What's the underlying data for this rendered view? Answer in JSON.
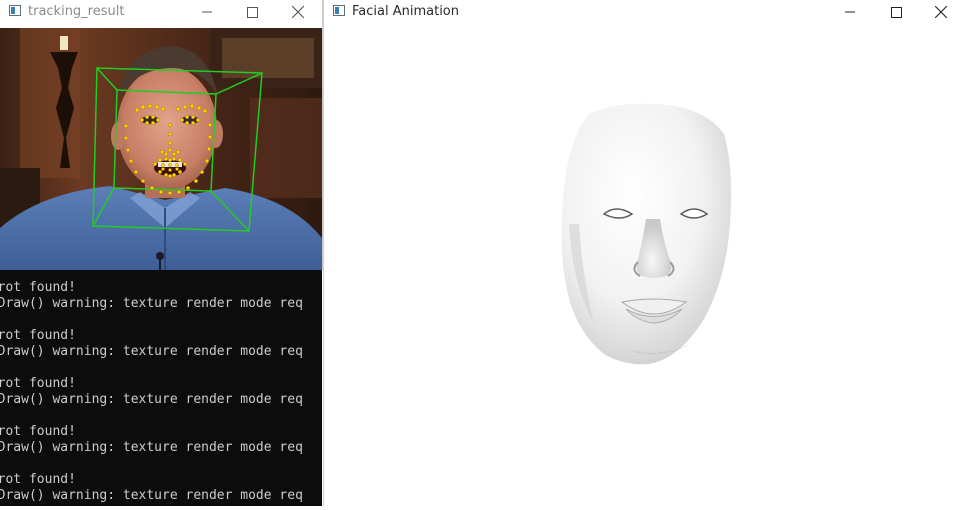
{
  "windows": {
    "tracking": {
      "title": "tracking_result"
    },
    "animation": {
      "title": "Facial Animation"
    }
  },
  "console": {
    "lines": [
      "o rot found!",
      "imDraw() warning: texture render mode req",
      "",
      "o rot found!",
      "imDraw() warning: texture render mode req",
      "",
      "o rot found!",
      "imDraw() warning: texture render mode req",
      "",
      "o rot found!",
      "imDraw() warning: texture render mode req",
      "",
      "o rot found!",
      "imDraw() warning: texture render mode req"
    ]
  },
  "icons": {
    "minimize": "minimize-icon",
    "maximize": "maximize-icon",
    "close": "close-icon",
    "app": "app-window-icon"
  },
  "colors": {
    "bounding_box": "#22cc22",
    "landmarks": "#ffd400",
    "console_bg": "#0c0c0c",
    "console_text": "#cccccc"
  }
}
